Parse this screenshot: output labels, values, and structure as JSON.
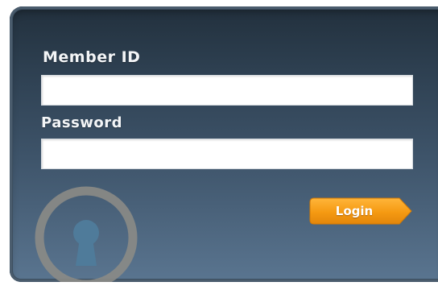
{
  "form": {
    "member_id_label": "Member ID",
    "password_label": "Password",
    "member_id_value": "",
    "password_value": "",
    "login_label": "Login"
  },
  "icons": {
    "lock": "keyhole-icon",
    "arrow": "arrow-right-icon"
  },
  "colors": {
    "panel_top": "#22303d",
    "panel_bottom": "#5a7590",
    "button": "#f59a12",
    "label": "#f3f5f7"
  }
}
